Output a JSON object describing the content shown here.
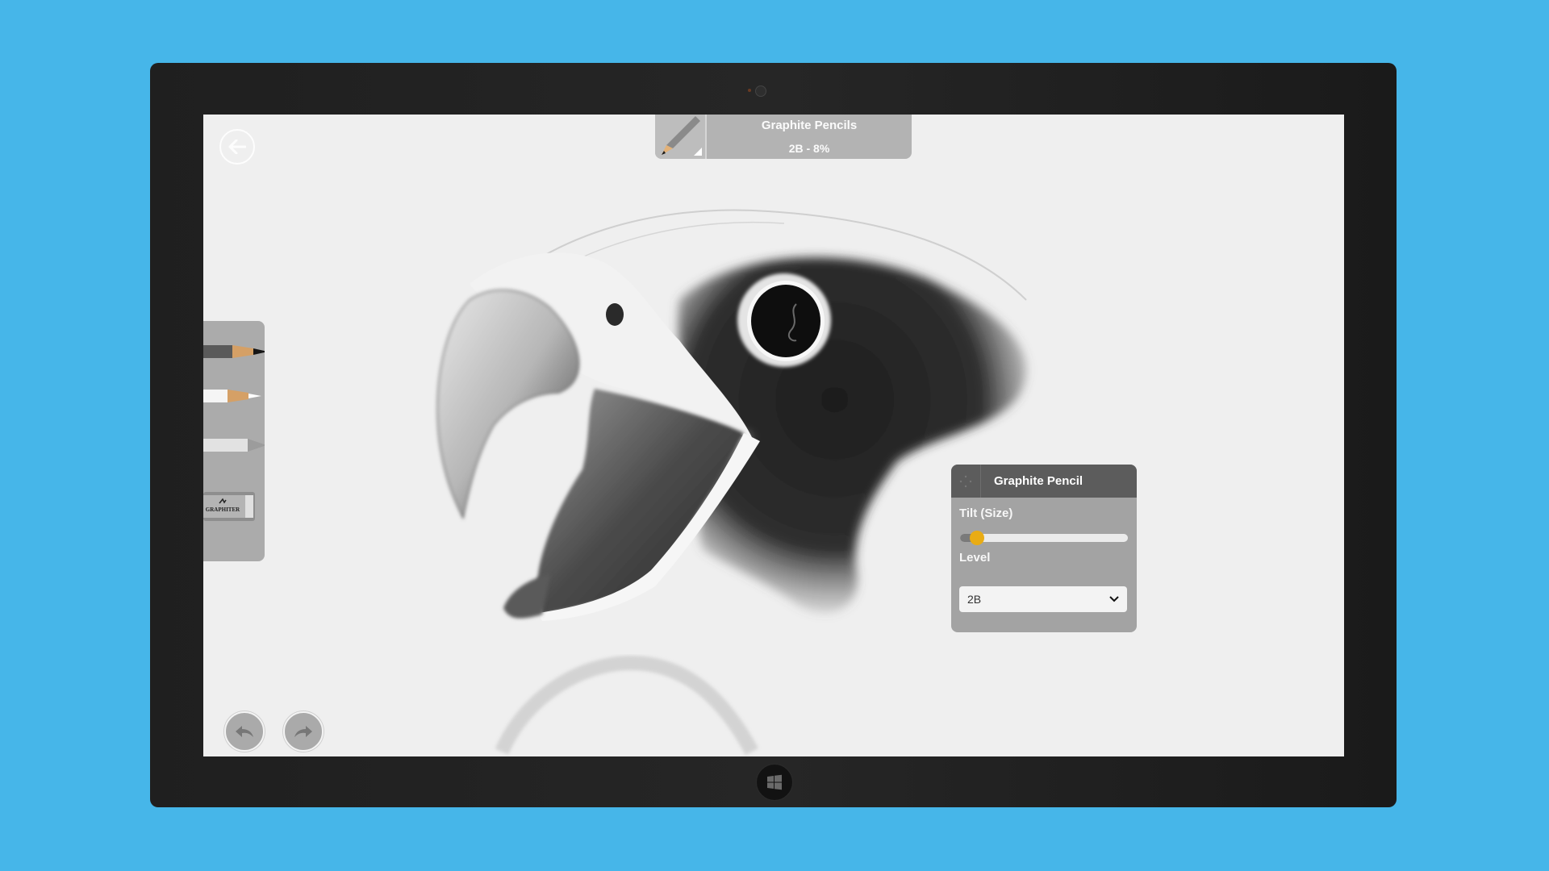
{
  "device": {
    "background_color": "#46b6e9",
    "bezel_color": "#222222"
  },
  "app": {
    "back_icon": "back-arrow-icon",
    "tool_indicator": {
      "title": "Graphite Pencils",
      "status": "2B - 8%",
      "icon": "graphite-pencil-icon"
    },
    "tool_tray": {
      "items": [
        {
          "name": "graphite-pencil",
          "icon": "graphite-pencil-icon"
        },
        {
          "name": "white-pencil",
          "icon": "white-pencil-icon"
        },
        {
          "name": "blending-stump",
          "icon": "blending-stump-icon"
        },
        {
          "name": "eraser",
          "icon": "eraser-icon",
          "label": "GRAPHITER"
        }
      ]
    },
    "undo_icon": "undo-icon",
    "redo_icon": "redo-icon",
    "pencil_panel": {
      "title": "Graphite Pencil",
      "tilt_label": "Tilt (Size)",
      "tilt_percent": 8,
      "level_label": "Level",
      "level_value": "2B",
      "accent_color": "#e9ac14"
    },
    "canvas": {
      "subject": "graphite drawing of a falcon head with open beak"
    }
  }
}
